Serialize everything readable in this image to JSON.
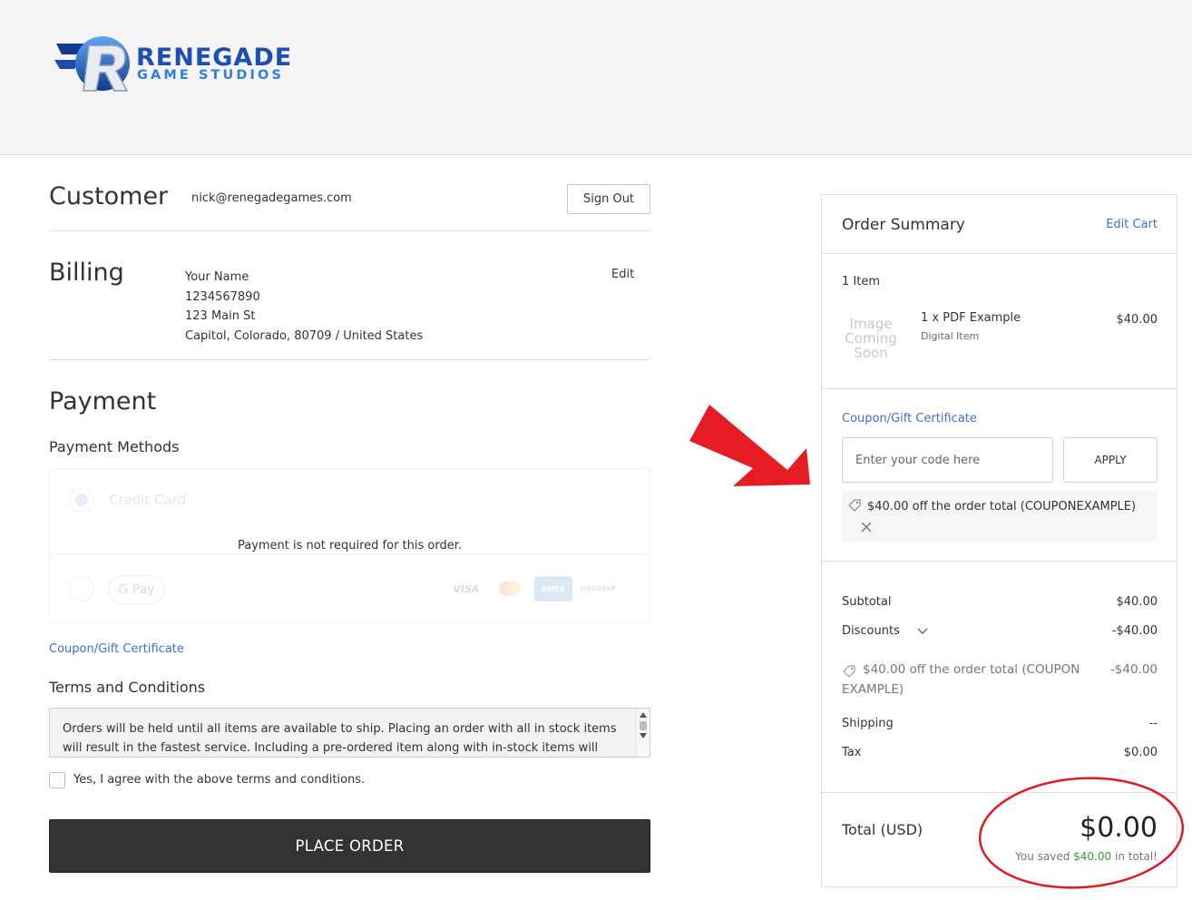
{
  "header": {
    "logo_word1": "RENEGADE",
    "logo_word2": "GAME STUDIOS"
  },
  "customer": {
    "title": "Customer",
    "email": "nick@renegadegames.com",
    "sign_out_label": "Sign Out"
  },
  "billing": {
    "title": "Billing",
    "edit_label": "Edit",
    "name": "Your Name",
    "phone": "1234567890",
    "street": "123 Main St",
    "city_line": "Capitol, Colorado, 80709 / United States"
  },
  "payment": {
    "title": "Payment",
    "methods_title": "Payment Methods",
    "credit_card_label": "Credit Card",
    "not_required_message": "Payment is not required for this order.",
    "gpay_label": "G Pay",
    "card_logos": [
      "VISA",
      "AMEX",
      "DISCOVER"
    ]
  },
  "coupon_link": "Coupon/Gift Certificate",
  "terms": {
    "title": "Terms and Conditions",
    "text": "Orders will be held until all items are available to ship. Placing an order with all in stock items will result in the fastest service. Including a pre-ordered item along with in-stock items will",
    "agree_label": "Yes, I agree with the above terms and conditions."
  },
  "place_order_label": "PLACE ORDER",
  "summary": {
    "title": "Order Summary",
    "edit_cart_label": "Edit Cart",
    "item_count": "1 Item",
    "item": {
      "image_placeholder": "Image Coming Soon",
      "name": "1 x PDF Example",
      "type": "Digital Item",
      "price": "$40.00"
    },
    "coupon_link": "Coupon/Gift Certificate",
    "coupon_placeholder": "Enter your code here",
    "apply_label": "APPLY",
    "applied_coupon": "$40.00 off the order total (COUPONEXAMPLE)",
    "subtotal_label": "Subtotal",
    "subtotal_value": "$40.00",
    "discounts_label": "Discounts",
    "discounts_value": "-$40.00",
    "discount_line_1": "$40.00 off the order total (COUPON",
    "discount_line_2": "EXAMPLE)",
    "discount_line_value": "-$40.00",
    "shipping_label": "Shipping",
    "shipping_value": "--",
    "tax_label": "Tax",
    "tax_value": "$0.00",
    "total_label": "Total (USD)",
    "total_value": "$0.00",
    "saved_prefix": "You saved",
    "saved_amount": "$40.00",
    "saved_suffix": "in total!"
  },
  "colors": {
    "link": "#3b70d6",
    "button_dark": "#333333",
    "saved_green": "#3a9b3a",
    "annotation_red": "#e51c23"
  }
}
